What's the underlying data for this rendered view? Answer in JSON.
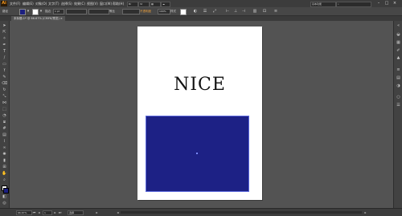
{
  "app": {
    "logo": "Ai"
  },
  "menu": [
    "文件(F)",
    "编辑(E)",
    "对象(O)",
    "文字(T)",
    "选择(S)",
    "效果(C)",
    "视图(V)",
    "窗口(W)",
    "帮助(H)"
  ],
  "workspace": {
    "label": "基本功能",
    "search": ""
  },
  "control_bar": {
    "object_label": "路径",
    "stroke_label": "描边",
    "stroke_weight": "1 pt",
    "brush_label": "等比",
    "opacity_label": "不透明度",
    "opacity_value": "100%",
    "style_label": "样式",
    "fill_color": "#1c2080",
    "stroke_color": "#ffffff"
  },
  "document_tab": {
    "label": "未标题-1* @ 66.67% (CMYK/预览)",
    "close": "×"
  },
  "artboard": {
    "text": "NICE",
    "rect_color": "#1d2185"
  },
  "status_bar": {
    "zoom": "66.67%",
    "page": "1",
    "mode": "选择"
  }
}
